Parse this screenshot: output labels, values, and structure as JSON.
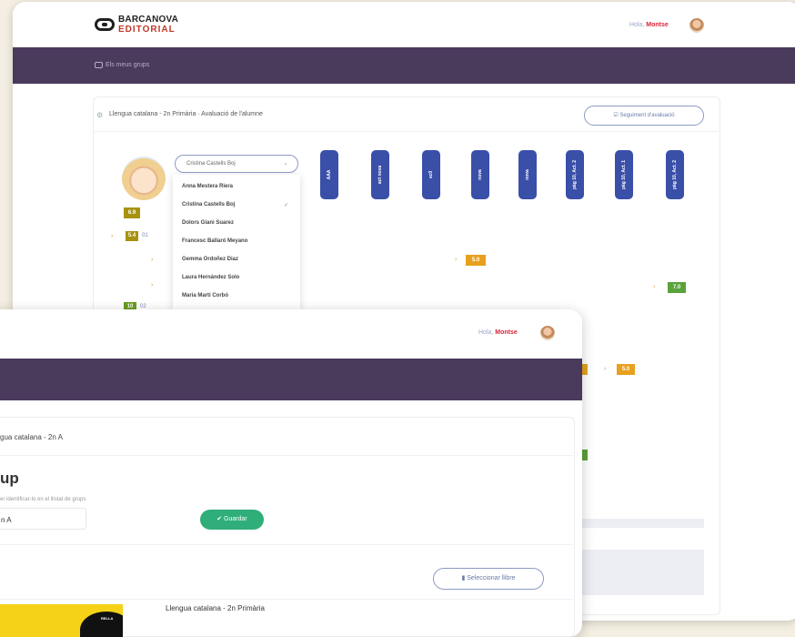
{
  "back": {
    "logo": {
      "line1": "BARCANOVA",
      "line2": "EDITORIAL"
    },
    "greeting": "Hola,",
    "user": "Montse",
    "nav_link": "Els meus grups",
    "breadcrumb": "Llengua catalana - 2n Primària · Avaluació de l'alumne",
    "tracking_button": "Seguiment d'avaluació",
    "student": {
      "selected": "Cristina Castells Boj",
      "grade": "6.9",
      "sub_grade": "5.4",
      "sub_code": "01",
      "bottom_grade": "10",
      "bottom_code": "02"
    },
    "dropdown_items": [
      "Anna Mestera Riera",
      "Cristina Castells Boj",
      "Dolors Giani Suarez",
      "Francesc Ballaró Meyano",
      "Gemma Ordoñez Diaz",
      "Laura Hernández Solo",
      "Maria Martí Corbó"
    ],
    "column_headers": [
      "AAA",
      "act nova",
      "sc0",
      "nova",
      "nova",
      "pàg 10, Act. 2",
      "pàg 10, Act. 1",
      "pàg 10, Act. 2"
    ],
    "score_values": {
      "s1": "5.0",
      "s2": "7.0",
      "s3": "5.0"
    },
    "colors": {
      "navbar": "#4a3a5c",
      "column": "#3a4fa8",
      "grade_olive": "#a79212",
      "grade_orange": "#e7a11e",
      "grade_green": "#5aa23a"
    }
  },
  "front": {
    "greeting": "Hola,",
    "user": "Montse",
    "breadcrumb": "gua catalana - 2n A",
    "heading": "up",
    "help": "er identificar-lo en el llistat de grups",
    "input_value": "n A",
    "save_button": "✔ Guardar",
    "select_book_button": "Seleccionar llibre",
    "book_title": "Llengua catalana - 2n Primària",
    "book_logo_text": "RELLA",
    "colors": {
      "save": "#2fae7a"
    }
  }
}
